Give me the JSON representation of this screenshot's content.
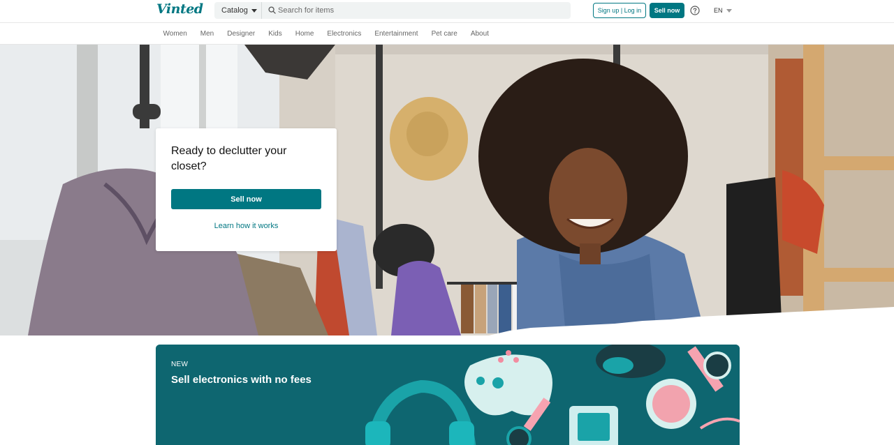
{
  "brand": {
    "logo_text": "Vinted",
    "accent_color": "#007782"
  },
  "header": {
    "catalog_label": "Catalog",
    "search_placeholder": "Search for items",
    "signup_label": "Sign up | Log in",
    "sell_label": "Sell now",
    "help_icon": "question-circle-icon",
    "language": "EN"
  },
  "nav": {
    "items": [
      {
        "label": "Women"
      },
      {
        "label": "Men"
      },
      {
        "label": "Designer"
      },
      {
        "label": "Kids"
      },
      {
        "label": "Home"
      },
      {
        "label": "Electronics"
      },
      {
        "label": "Entertainment"
      },
      {
        "label": "Pet care"
      },
      {
        "label": "About"
      }
    ]
  },
  "hero": {
    "title": "Ready to declutter your closet?",
    "sell_button": "Sell now",
    "learn_link": "Learn how it works"
  },
  "banner": {
    "tag": "NEW",
    "title": "Sell electronics with no fees"
  }
}
